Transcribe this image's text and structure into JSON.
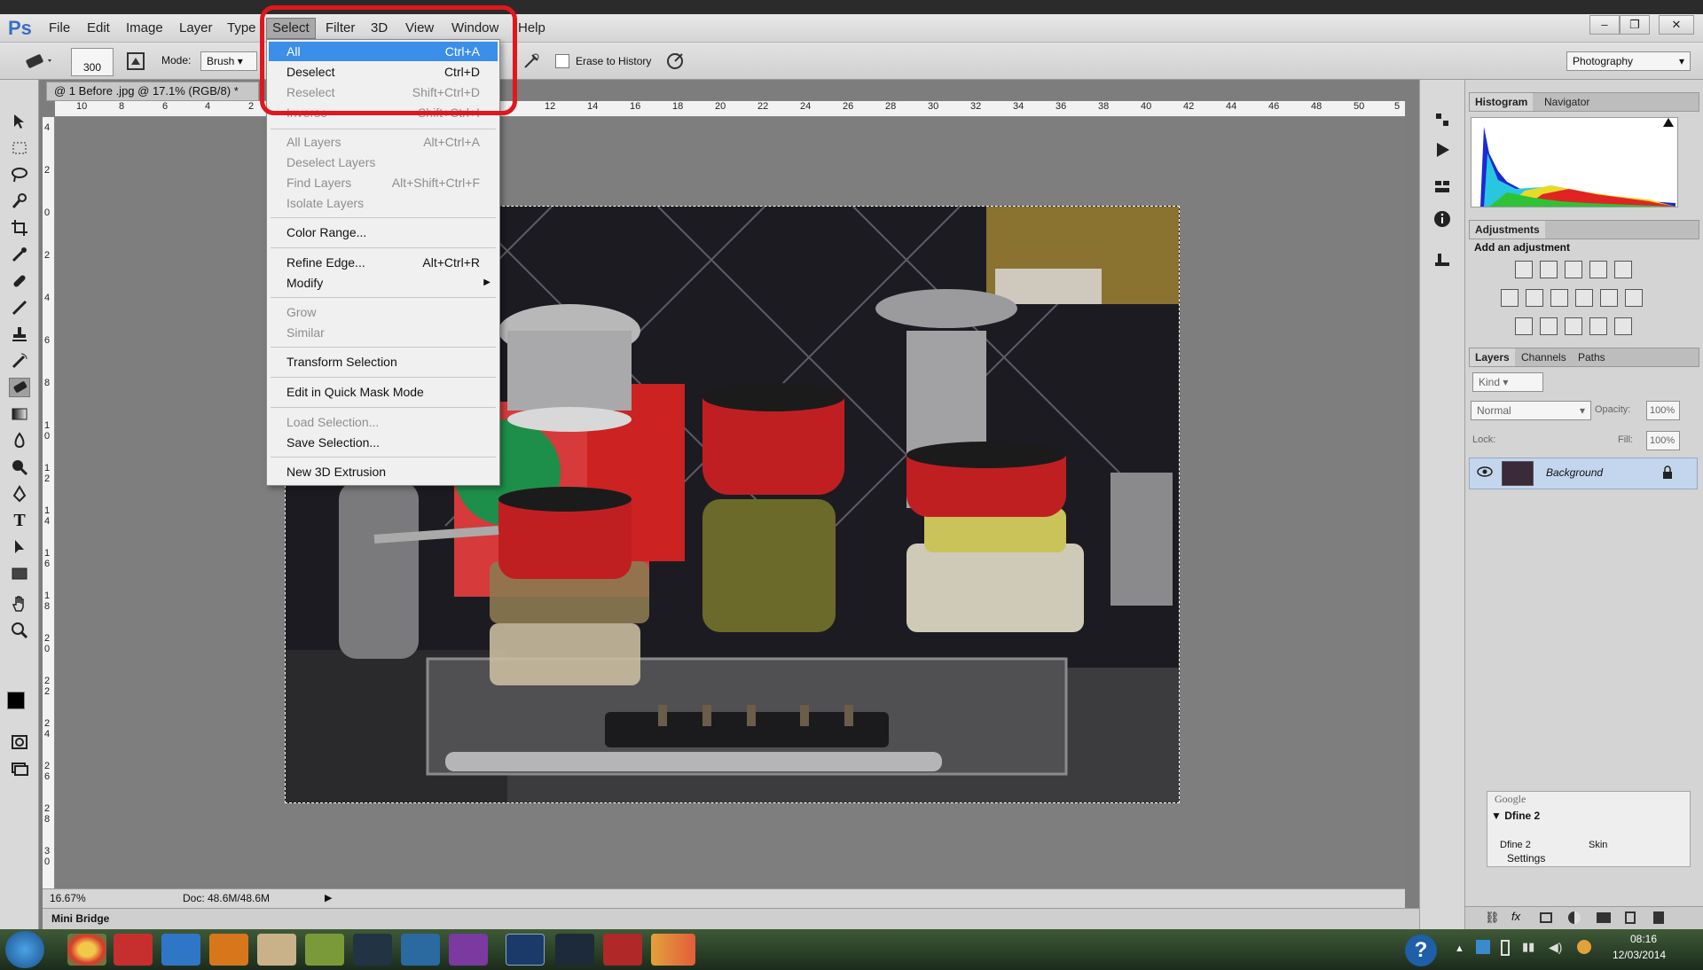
{
  "app": {
    "logo": "Ps",
    "doc_tab": "@ 1 Before .jpg @ 17.1% (RGB/8) *",
    "workspace": "Photography"
  },
  "menubar": [
    "File",
    "Edit",
    "Image",
    "Layer",
    "Type",
    "Select",
    "Filter",
    "3D",
    "View",
    "Window",
    "Help"
  ],
  "window_controls": {
    "minimize": "–",
    "restore": "❐",
    "close": "✕"
  },
  "options": {
    "brush_size": "300",
    "mode_label": "Mode:",
    "mode_value": "Brush",
    "erase_history": "Erase to History"
  },
  "select_menu": {
    "all": {
      "label": "All",
      "shortcut": "Ctrl+A"
    },
    "deselect": {
      "label": "Deselect",
      "shortcut": "Ctrl+D"
    },
    "reselect": {
      "label": "Reselect",
      "shortcut": "Shift+Ctrl+D"
    },
    "inverse": {
      "label": "Inverse",
      "shortcut": "Shift+Ctrl+I"
    },
    "all_layers": {
      "label": "All Layers",
      "shortcut": "Alt+Ctrl+A"
    },
    "deselect_layers": {
      "label": "Deselect Layers"
    },
    "find_layers": {
      "label": "Find Layers",
      "shortcut": "Alt+Shift+Ctrl+F"
    },
    "isolate_layers": {
      "label": "Isolate Layers"
    },
    "color_range": {
      "label": "Color Range..."
    },
    "refine_edge": {
      "label": "Refine Edge...",
      "shortcut": "Alt+Ctrl+R"
    },
    "modify": {
      "label": "Modify"
    },
    "grow": {
      "label": "Grow"
    },
    "similar": {
      "label": "Similar"
    },
    "transform_selection": {
      "label": "Transform Selection"
    },
    "quick_mask": {
      "label": "Edit in Quick Mask Mode"
    },
    "load_selection": {
      "label": "Load Selection..."
    },
    "save_selection": {
      "label": "Save Selection..."
    },
    "new_3d_extrusion": {
      "label": "New 3D Extrusion"
    }
  },
  "ruler_top": [
    "10",
    "8",
    "6",
    "4",
    "2",
    "12",
    "14",
    "16",
    "18",
    "20",
    "22",
    "24",
    "26",
    "28",
    "30",
    "32",
    "34",
    "36",
    "38",
    "40",
    "42",
    "44",
    "46",
    "48",
    "50",
    "5"
  ],
  "ruler_left": [
    "4",
    "2",
    "0",
    "2",
    "4",
    "6",
    "8",
    "1 0",
    "1 2",
    "1 4",
    "1 6",
    "1 8",
    "2 0",
    "2 2",
    "2 4",
    "2 6",
    "2 8",
    "3 0"
  ],
  "status": {
    "zoom": "16.67%",
    "doc": "Doc: 48.6M/48.6M",
    "mini_bridge": "Mini Bridge"
  },
  "panels": {
    "histogram_tab": "Histogram",
    "navigator_tab": "Navigator",
    "adjustments_tab": "Adjustments",
    "add_adjustment": "Add an adjustment",
    "layers_tab": "Layers",
    "channels_tab": "Channels",
    "paths_tab": "Paths",
    "kind": "Kind",
    "blend": "Normal",
    "opacity_label": "Opacity:",
    "opacity": "100%",
    "lock_label": "Lock:",
    "fill_label": "Fill:",
    "fill": "100%",
    "layer_name": "Background"
  },
  "google_widget": {
    "title": "Google",
    "header": "Dfine 2",
    "col1": "Dfine 2",
    "col2": "Skin",
    "settings": "Settings"
  },
  "taskbar": {
    "time": "08:16",
    "date": "12/03/2014",
    "help": "?"
  },
  "colors": {
    "highlight": "#3c8fe8",
    "annotation_ring": "#e0171d",
    "ps_blue": "#3a6fc2"
  }
}
